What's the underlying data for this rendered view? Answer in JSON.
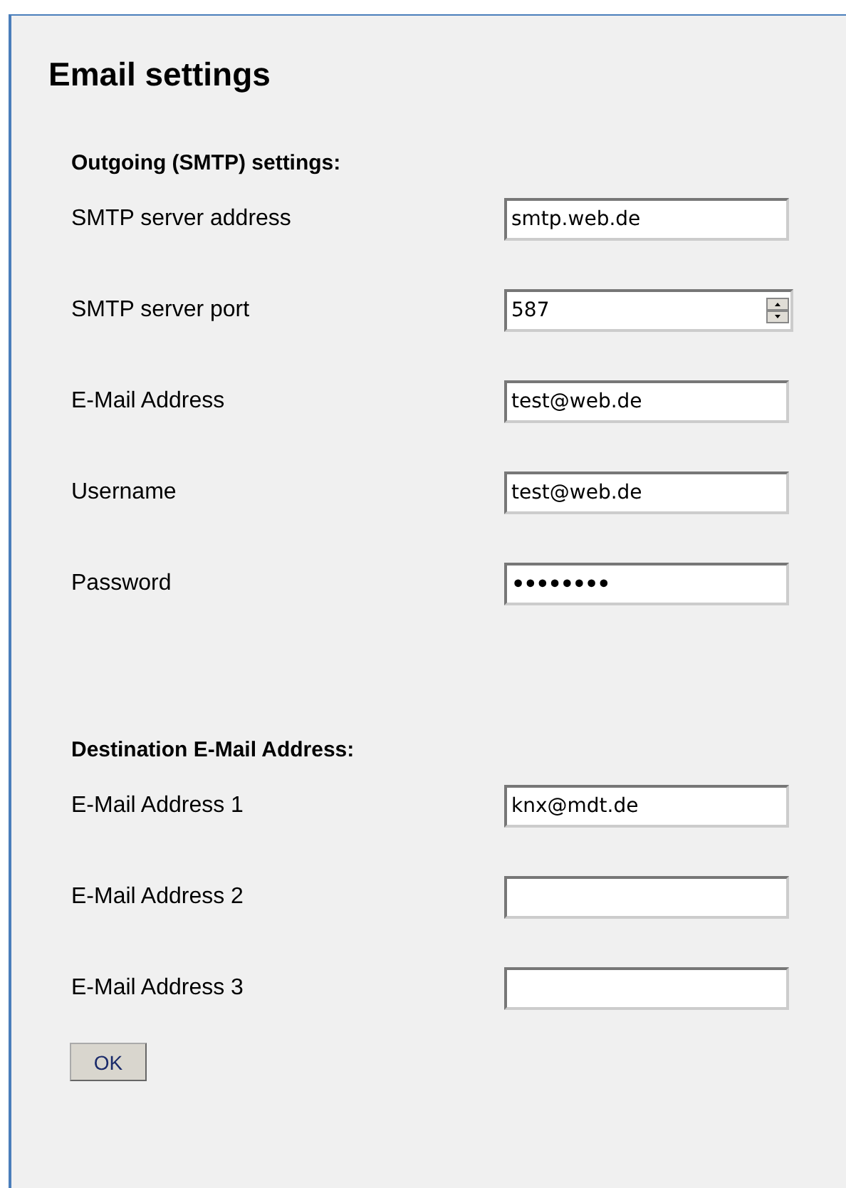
{
  "title": "Email settings",
  "sections": [
    {
      "heading": "Outgoing (SMTP) settings:",
      "fields": [
        {
          "label": "SMTP server address",
          "kind": "text",
          "value": "smtp.web.de"
        },
        {
          "label": "SMTP server port",
          "kind": "number",
          "value": "587"
        },
        {
          "label": "E-Mail Address",
          "kind": "text",
          "value": "test@web.de"
        },
        {
          "label": "Username",
          "kind": "text",
          "value": "test@web.de"
        },
        {
          "label": "Password",
          "kind": "password",
          "value": "••••••••"
        }
      ]
    },
    {
      "heading": "Destination E-Mail Address:",
      "fields": [
        {
          "label": "E-Mail Address 1",
          "kind": "text",
          "value": "knx@mdt.de"
        },
        {
          "label": "E-Mail Address 2",
          "kind": "text"
        },
        {
          "label": "E-Mail Address 3",
          "kind": "text"
        }
      ]
    }
  ],
  "button": "OK"
}
